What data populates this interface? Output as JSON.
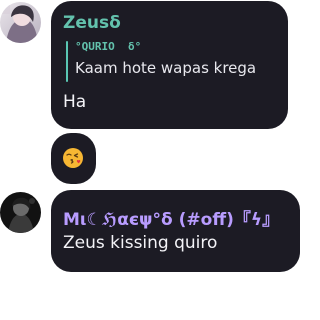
{
  "messages": [
    {
      "author": "Zeusδ",
      "author_color": "#63c2ad",
      "reply": {
        "author": "°QURIO  δ°",
        "text": "Kaam hote wapas krega"
      },
      "text": "Ha"
    },
    {
      "emoji": "😘",
      "emoji_name": "face-blowing-a-kiss"
    },
    {
      "author": "Μι☾ℌαєψ°δ (#off)『ϟ』",
      "author_color": "#b89cff",
      "text": "Zeus kissing quiro"
    }
  ],
  "theme": {
    "bubble_color": "#1c1b24",
    "reply_accent": "#5ac6b3",
    "background": "#ffffff"
  }
}
